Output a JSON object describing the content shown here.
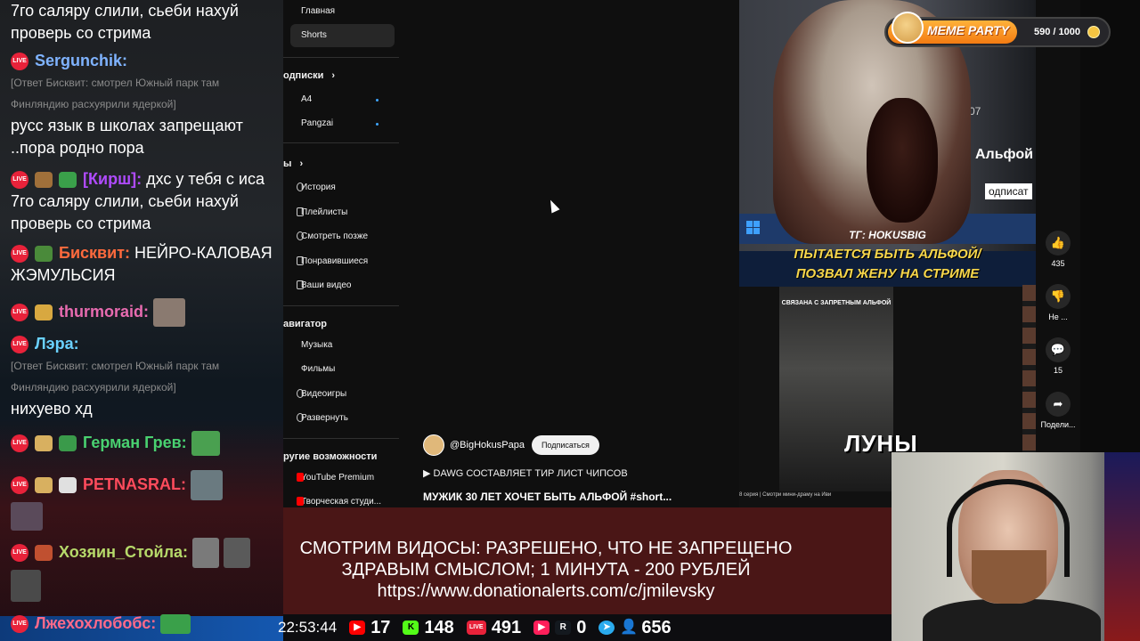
{
  "chat": {
    "messages": [
      {
        "text": "7го саляру слили, сьеби нахуй проверь со стрима"
      },
      {
        "nick": "Sergunchik:",
        "nick_color": "#7fb3ff",
        "reply": "[Ответ Бисквит: смотрел Южный парк там Финляндию расхуярили ядеркой]",
        "text": "русс язык в школах запрещают ..пора родно пора"
      },
      {
        "nick": "[Кирш]:",
        "nick_color": "#b04bff",
        "text": "дхс у тебя с иса 7го саляру слили, сьеби нахуй проверь со стрима"
      },
      {
        "nick": "Бисквит:",
        "nick_color": "#ff6a3d",
        "text": "НЕЙРО-КАЛОВАЯ ЖЭМУЛЬСИЯ"
      },
      {
        "nick": "thurmoraid:",
        "nick_color": "#e86bb0",
        "text": ""
      },
      {
        "nick": "Лэра:",
        "nick_color": "#6ad1ff",
        "reply": "[Ответ Бисквит: смотрел Южный парк там Финляндию расхуярили ядеркой]",
        "text": "нихуево хд"
      },
      {
        "nick": "Герман Грев:",
        "nick_color": "#49d170",
        "text": ""
      },
      {
        "nick": "PETNASRAL:",
        "nick_color": "#ff4b5c",
        "text": ""
      },
      {
        "nick": "Хозяин_Стойла:",
        "nick_color": "#b6d96a",
        "text": ""
      },
      {
        "nick": "Лжехохлобобс:",
        "nick_color": "#ff6a8a",
        "text": ""
      }
    ],
    "live_badge": "LIVE"
  },
  "youtube_sidebar": {
    "items_top": [
      "Главная",
      "Shorts"
    ],
    "subscriptions_head": "одписки",
    "subscriptions": [
      "A4",
      "Pangzai"
    ],
    "you_head": "ы",
    "you_items": [
      "История",
      "Плейлисты",
      "Смотреть позже",
      "Понравившиеся",
      "Ваши видео"
    ],
    "navigator_head": "авигатор",
    "navigator_items": [
      "Музыка",
      "Фильмы",
      "Видеоигры",
      "Развернуть"
    ],
    "more_head": "ругие возможности",
    "more_items": [
      "YouTube Premium",
      "Творческая студи..."
    ]
  },
  "short": {
    "channel": "@BigHokusPapa",
    "subscribe": "Подписаться",
    "playlist": "DAWG СОСТАВЛЯЕТ ТИР ЛИСТ ЧИПСОВ",
    "title": "МУЖИК 30 ЛЕТ ХОЧЕТ БЫТЬ АЛЬФОЙ #short..."
  },
  "video": {
    "tg": "ТГ: HOKUSBIG",
    "caption_line1": "ПЫТАЕТСЯ БЫТЬ АЛЬФОЙ/",
    "caption_line2": "ПОЗВАЛ ЖЕНУ НА СТРИМЕ",
    "inner_caption": "СВЯЗАНА С ЗАПРЕТНЫМ АЛЬФОЙ",
    "big_word": "ЛУНЫ",
    "alpha_text": "Альфой",
    "follow_text": "одписат",
    "num": "07",
    "bottom_info": "8 серия | Смотри мини-драму на Иви"
  },
  "actions": {
    "likes": "435",
    "dislike": "Не ...",
    "comments": "15",
    "share": "Подели..."
  },
  "meme_party": {
    "label": "MEME PARTY",
    "count": "590 / 1000",
    "progress": 0.59
  },
  "banner": {
    "line1": "СМОТРИМ ВИДОСЫ: РАЗРЕШЕНО, ЧТО НЕ ЗАПРЕЩЕНО",
    "line2": "ЗДРАВЫМ СМЫСЛОМ; 1 МИНУТА - 200 РУБЛЕЙ",
    "line3": "https://www.donationalerts.com/c/jmilevsky"
  },
  "stats": {
    "clock": "22:53:44",
    "youtube": "17",
    "kick": "148",
    "vk_live": "491",
    "rutube": "0",
    "telegram": "656"
  },
  "colors": {
    "youtube": "#ff0000",
    "kick": "#53fc18",
    "vk_live": "#e8223a",
    "telegram": "#2aabee",
    "viewers": "#5aa8ff"
  }
}
